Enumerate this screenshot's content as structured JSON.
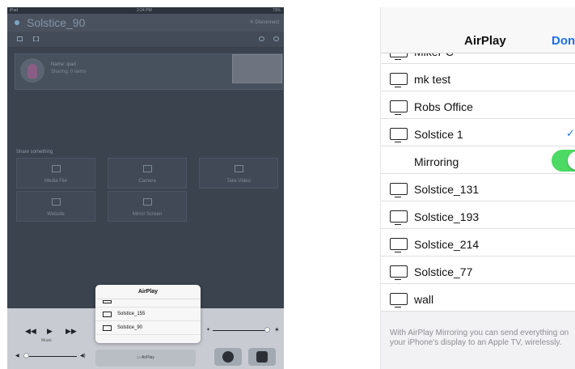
{
  "ipad": {
    "status": {
      "carrier": "iPad",
      "time": "2:24 PM",
      "battery": "73%"
    },
    "title": "Solstice_90",
    "disconnect_label": "Disconnect",
    "user": {
      "name": "Name: ipad",
      "sharing": "Sharing: 0 items"
    },
    "share_heading": "Share something",
    "tiles": [
      "Media File",
      "Camera",
      "Take Video",
      "Website",
      "Mirror Screen"
    ],
    "playback": {
      "rewind": "◀◀",
      "play": "▶",
      "forward": "▶▶",
      "track": "Music"
    },
    "airplay_button_label": "AirPlay",
    "popover": {
      "title": "AirPlay",
      "rows": [
        "Solstice_155",
        "Solstice_90"
      ]
    }
  },
  "iphone": {
    "title": "AirPlay",
    "done_label": "Done",
    "devices": [
      "MikePC",
      "mk test",
      "Robs Office",
      "Solstice 1"
    ],
    "selected_device_check": "✓",
    "mirroring_label": "Mirroring",
    "mirroring_on": true,
    "more_devices": [
      "Solstice_131",
      "Solstice_193",
      "Solstice_214",
      "Solstice_77",
      "wall"
    ],
    "footer": "With AirPlay Mirroring you can send everything on your iPhone's display to an Apple TV, wirelessly."
  },
  "colors": {
    "accent": "#1f6fe5",
    "toggle_on": "#4cd964",
    "ipad_bg": "#3b434f"
  }
}
